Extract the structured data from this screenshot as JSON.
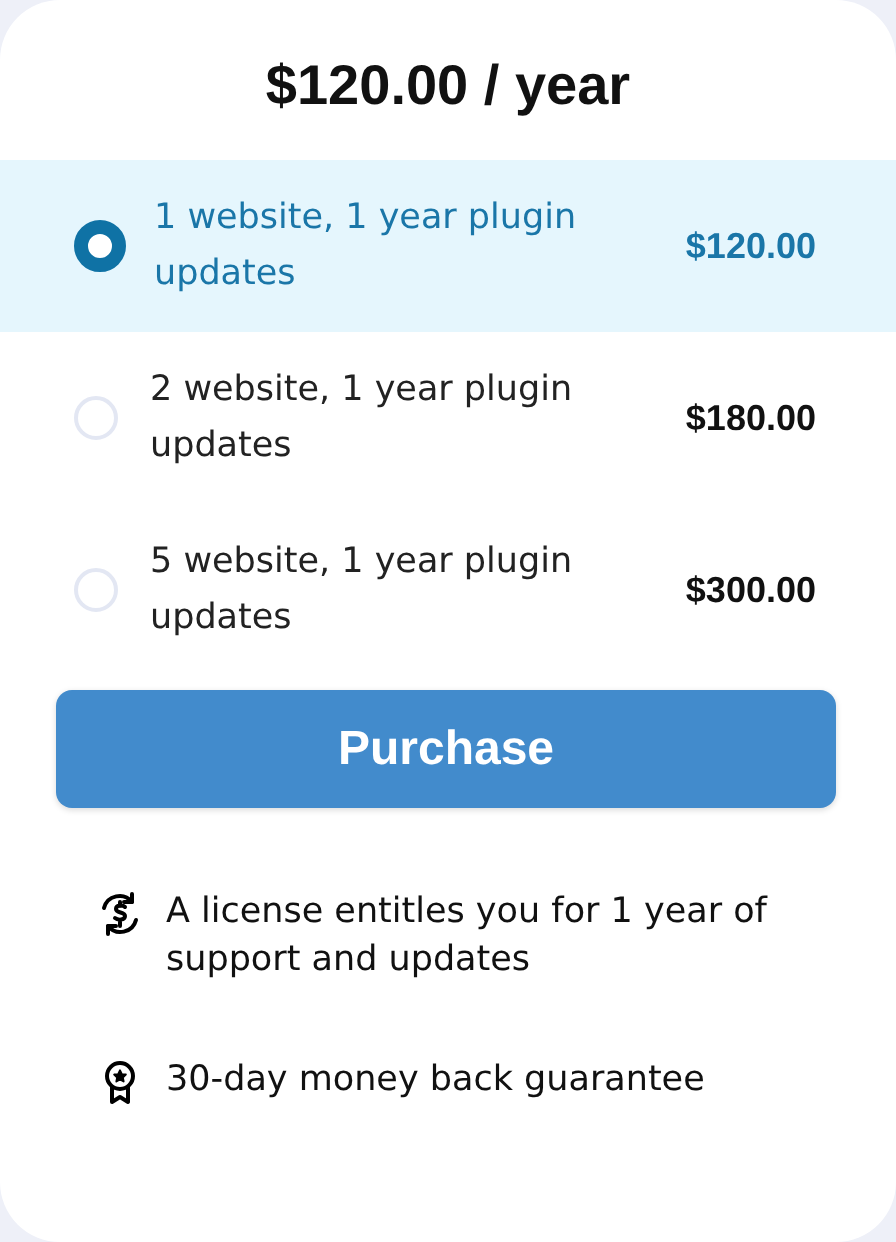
{
  "title": "$120.00 / year",
  "options": [
    {
      "label": "1 website, 1 year plugin updates",
      "price": "$120.00",
      "selected": true
    },
    {
      "label": "2 website, 1 year plugin updates",
      "price": "$180.00",
      "selected": false
    },
    {
      "label": "5 website, 1 year plugin updates",
      "price": "$300.00",
      "selected": false
    }
  ],
  "button": "Purchase",
  "features": [
    {
      "kind": "renew",
      "text": "A license entitles you for 1 year of support and updates"
    },
    {
      "kind": "award",
      "text": "30-day money back guarantee"
    }
  ]
}
